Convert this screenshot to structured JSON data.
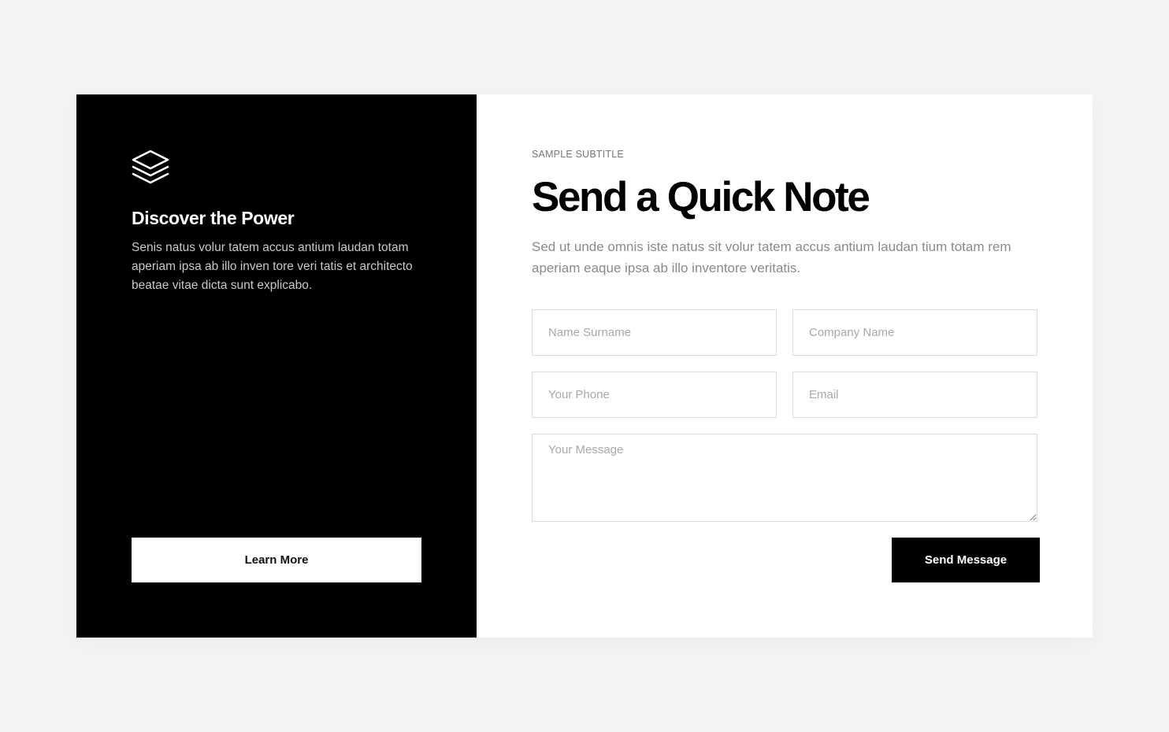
{
  "left_panel": {
    "icon": "layers-icon",
    "title": "Discover the Power",
    "text": "Senis natus volur tatem accus antium laudan totam aperiam ipsa ab illo inven tore veri tatis et architecto beatae vitae dicta sunt explicabo.",
    "button_label": "Learn More"
  },
  "right_panel": {
    "subtitle": "Sample Subtitle",
    "title": "Send a Quick Note",
    "description": "Sed ut unde omnis iste natus sit volur tatem accus antium laudan tium totam rem aperiam eaque ipsa ab illo inventore veritatis."
  },
  "form": {
    "name_placeholder": "Name Surname",
    "company_placeholder": "Company Name",
    "phone_placeholder": "Your Phone",
    "email_placeholder": "Email",
    "message_placeholder": "Your Message",
    "submit_label": "Send Message"
  },
  "colors": {
    "page_background": "#f4f4f4",
    "dark_panel": "#000000",
    "card_background": "#ffffff",
    "muted_text": "#8a8a8a"
  }
}
